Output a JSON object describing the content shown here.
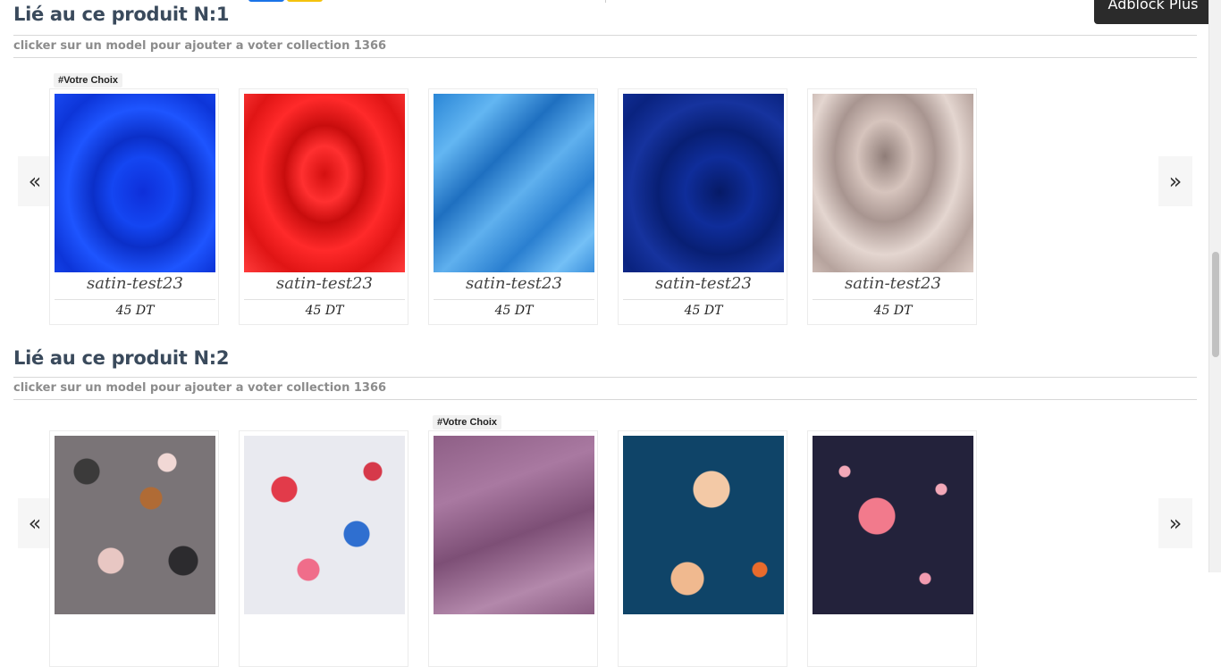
{
  "adblock": {
    "label": "Adblock Plus"
  },
  "sections": [
    {
      "title": "Lié au ce produit N:1",
      "subtitle": "clicker sur un model pour ajouter a voter collection 1366",
      "nav": {
        "prev": "«",
        "next": "»"
      },
      "badge": "#Votre Choix",
      "items": [
        {
          "name": "satin-test23",
          "price": "45 DT"
        },
        {
          "name": "satin-test23",
          "price": "45 DT"
        },
        {
          "name": "satin-test23",
          "price": "45 DT"
        },
        {
          "name": "satin-test23",
          "price": "45 DT"
        },
        {
          "name": "satin-test23",
          "price": "45 DT"
        }
      ]
    },
    {
      "title": "Lié au ce produit N:2",
      "subtitle": "clicker sur un model pour ajouter a voter collection 1366",
      "nav": {
        "prev": "«",
        "next": "»"
      },
      "badge": "#Votre Choix"
    }
  ]
}
